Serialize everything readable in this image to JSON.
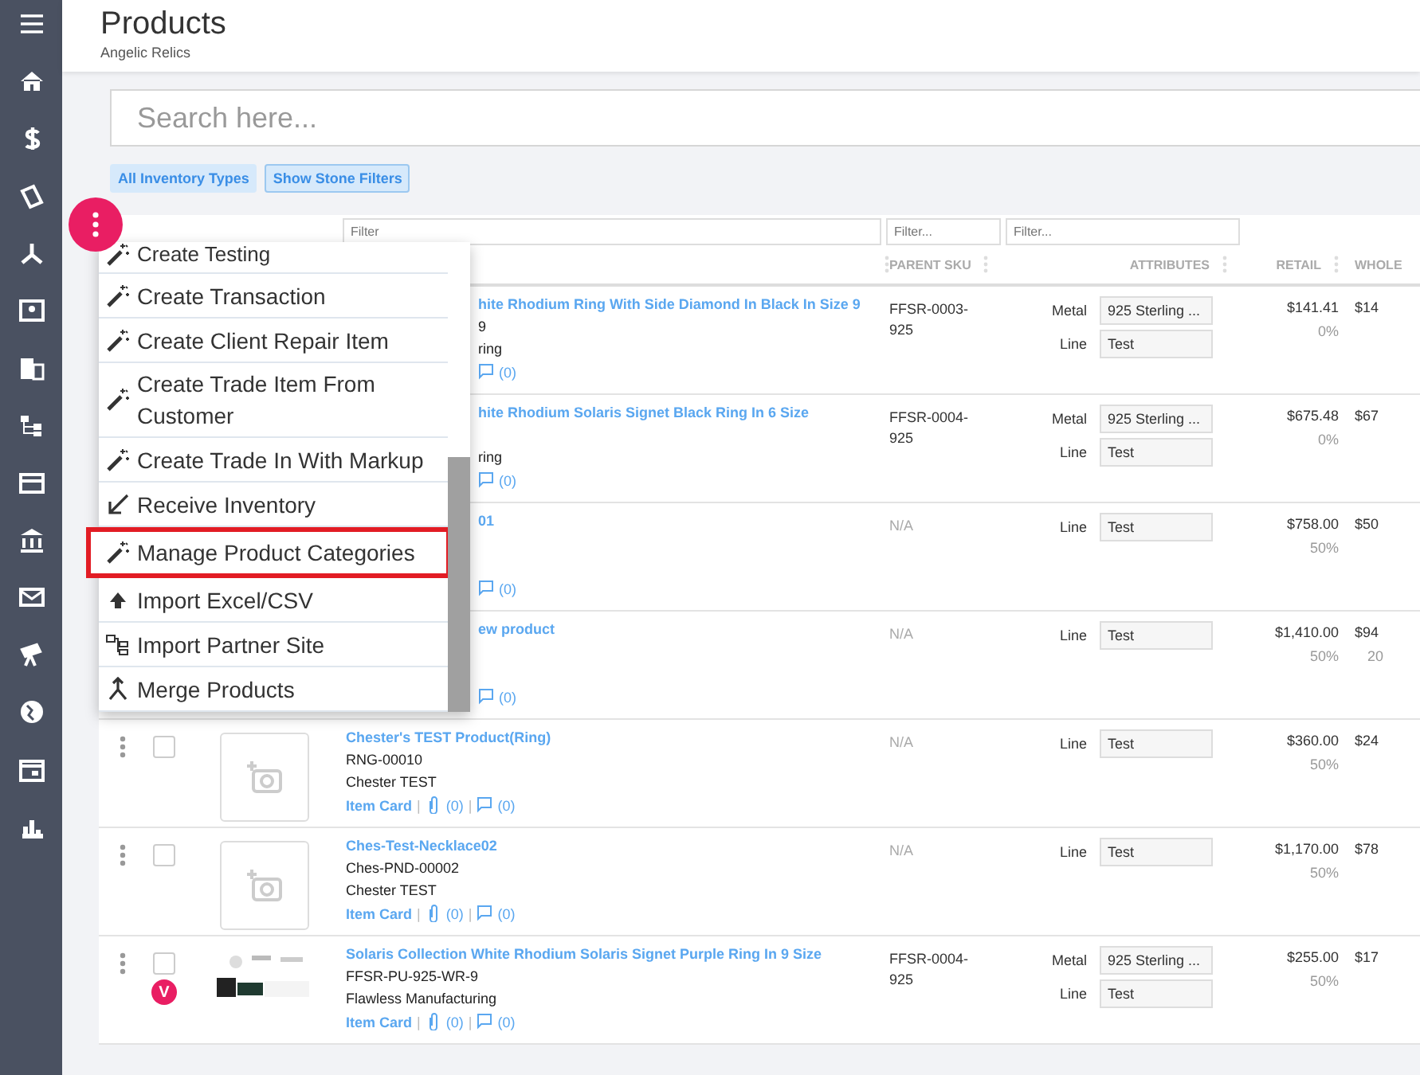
{
  "page": {
    "title": "Products",
    "subtitle": "Angelic Relics"
  },
  "search": {
    "placeholder": "Search here..."
  },
  "filter_chips": [
    {
      "label": "All Inventory Types",
      "selected": false
    },
    {
      "label": "Show Stone Filters",
      "selected": true
    }
  ],
  "column_filters": [
    {
      "placeholder": "Filter"
    },
    {
      "placeholder": "Filter..."
    },
    {
      "placeholder": "Filter..."
    }
  ],
  "table": {
    "columns": [
      "PARENT SKU",
      "ATTRIBUTES",
      "RETAIL",
      "WHOLE"
    ],
    "rows": [
      {
        "kind": "covered",
        "title": "hite Rhodium Ring With Side Diamond In Black In Size 9",
        "sku_tail": "9",
        "vendor": "ring",
        "comments": "(0)",
        "parent_sku": "FFSR-0003-925",
        "parent_sku_muted": false,
        "attributes": [
          {
            "label": "Metal",
            "value": "925 Sterling ..."
          },
          {
            "label": "Line",
            "value": "Test"
          }
        ],
        "retail": "$141.41",
        "markup": "0%",
        "wholesale": "$14"
      },
      {
        "kind": "covered",
        "title": "hite Rhodium Solaris Signet Black Ring In 6 Size",
        "vendor": "ring",
        "comments": "(0)",
        "parent_sku": "FFSR-0004-925",
        "parent_sku_muted": false,
        "attributes": [
          {
            "label": "Metal",
            "value": "925 Sterling ..."
          },
          {
            "label": "Line",
            "value": "Test"
          }
        ],
        "retail": "$675.48",
        "markup": "0%",
        "wholesale": "$67"
      },
      {
        "kind": "covered",
        "title": "01",
        "comments": "(0)",
        "parent_sku": "N/A",
        "parent_sku_muted": true,
        "attributes": [
          {
            "label": "Line",
            "value": "Test"
          }
        ],
        "retail": "$758.00",
        "markup": "50%",
        "wholesale": "$50"
      },
      {
        "kind": "covered",
        "title": "ew product",
        "comments": "(0)",
        "parent_sku": "N/A",
        "parent_sku_muted": true,
        "attributes": [
          {
            "label": "Line",
            "value": "Test"
          }
        ],
        "retail": "$1,410.00",
        "markup": "50%",
        "wholesale": "$94",
        "wholesale_note": "20"
      },
      {
        "kind": "placeholder",
        "checked": false,
        "title": "Chester's TEST Product(Ring)",
        "sku": "RNG-00010",
        "vendor": "Chester TEST",
        "item_card": "Item Card",
        "separator": "|",
        "attachments": "(0)",
        "comments": "(0)",
        "parent_sku": "N/A",
        "parent_sku_muted": true,
        "attributes": [
          {
            "label": "Line",
            "value": "Test"
          }
        ],
        "retail": "$360.00",
        "markup": "50%",
        "wholesale": "$24"
      },
      {
        "kind": "placeholder",
        "checked": false,
        "title": "Ches-Test-Necklace02",
        "sku": "Ches-PND-00002",
        "vendor": "Chester TEST",
        "item_card": "Item Card",
        "separator": "|",
        "attachments": "(0)",
        "comments": "(0)",
        "parent_sku": "N/A",
        "parent_sku_muted": true,
        "attributes": [
          {
            "label": "Line",
            "value": "Test"
          }
        ],
        "retail": "$1,170.00",
        "markup": "50%",
        "wholesale": "$78"
      },
      {
        "kind": "photo",
        "checked": false,
        "badge": "V",
        "title": "Solaris Collection White Rhodium Solaris Signet Purple Ring In 9 Size",
        "sku": "FFSR-PU-925-WR-9",
        "vendor": "Flawless Manufacturing",
        "item_card": "Item Card",
        "separator": "|",
        "attachments": "(0)",
        "comments": "(0)",
        "parent_sku": "FFSR-0004-925",
        "parent_sku_muted": false,
        "attributes": [
          {
            "label": "Metal",
            "value": "925 Sterling ..."
          },
          {
            "label": "Line",
            "value": "Test"
          }
        ],
        "retail": "$255.00",
        "markup": "50%",
        "wholesale": "$17"
      }
    ]
  },
  "menu": {
    "items": [
      {
        "label": "Create Testing",
        "kind": "create",
        "highlighted": false
      },
      {
        "label": "Create Transaction",
        "kind": "create",
        "highlighted": false
      },
      {
        "label": "Create Client Repair Item",
        "kind": "create",
        "highlighted": false
      },
      {
        "label": "Create Trade Item From Customer",
        "kind": "create",
        "highlighted": false
      },
      {
        "label": "Create Trade In With Markup",
        "kind": "create",
        "highlighted": false
      },
      {
        "label": "Receive Inventory",
        "kind": "receive",
        "highlighted": false
      },
      {
        "label": "Manage Product Categories",
        "kind": "create",
        "highlighted": true
      },
      {
        "label": "Import Excel/CSV",
        "kind": "upload",
        "highlighted": false
      },
      {
        "label": "Import Partner Site",
        "kind": "site",
        "highlighted": false
      },
      {
        "label": "Merge Products",
        "kind": "merge",
        "highlighted": false
      }
    ]
  }
}
